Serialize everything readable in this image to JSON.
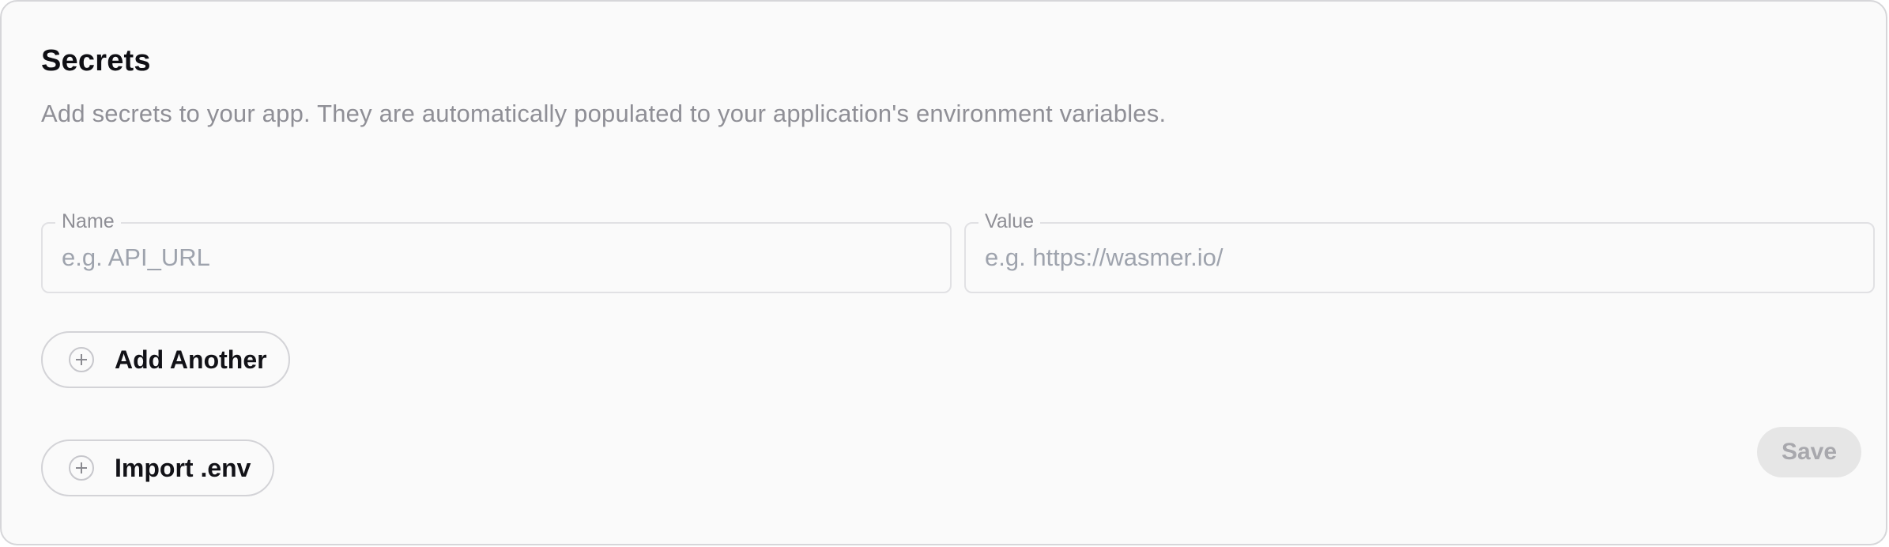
{
  "section": {
    "title": "Secrets",
    "description": "Add secrets to your app. They are automatically populated to your application's environment variables."
  },
  "fields": {
    "name": {
      "label": "Name",
      "value": "",
      "placeholder": "e.g. API_URL"
    },
    "value": {
      "label": "Value",
      "value": "",
      "placeholder": "e.g. https://wasmer.io/"
    }
  },
  "actions": {
    "add_another": {
      "label": "Add Another",
      "icon": "plus-circle-icon"
    },
    "import_env": {
      "label": "Import .env",
      "icon": "plus-circle-icon"
    },
    "save": {
      "label": "Save",
      "disabled": true
    }
  },
  "colors": {
    "background": "#fafafa",
    "border": "#d6d6d9",
    "text_primary": "#0f0f14",
    "text_muted": "#8f8f96",
    "placeholder": "#9ea3ad",
    "save_disabled_bg": "#e6e6e6",
    "save_disabled_text": "#a8a8ad"
  }
}
